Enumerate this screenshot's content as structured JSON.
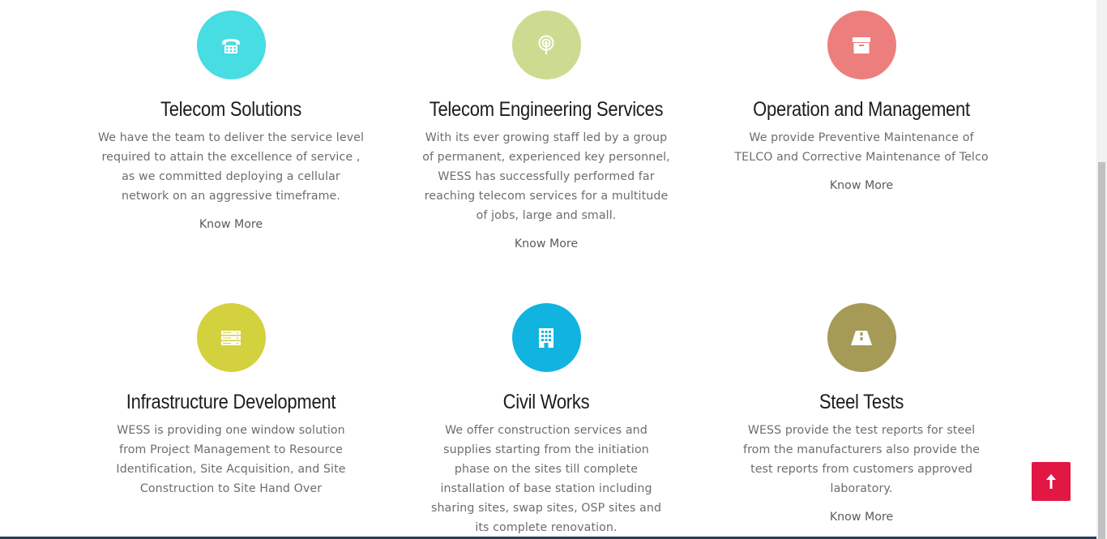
{
  "services": [
    {
      "title": "Telecom Solutions",
      "description": "We have the team to deliver the service level required to attain the excellence of service , as we committed deploying a cellular network on an aggressive timeframe.",
      "link": "Know More",
      "icon": "telephone-icon",
      "color": "#48dce3"
    },
    {
      "title": "Telecom Engineering Services",
      "description": "With its ever growing staff led by a group of permanent, experienced key personnel, WESS has successfully performed far reaching telecom services for a multitude of jobs, large and small.",
      "link": "Know More",
      "icon": "broadcast-icon",
      "color": "#cbdc90"
    },
    {
      "title": "Operation and Management",
      "description": "We provide Preventive Maintenance of TELCO and Corrective Maintenance of Telco",
      "link": "Know More",
      "icon": "archive-box-icon",
      "color": "#ec7f7d"
    },
    {
      "title": "Infrastructure Development",
      "description": "WESS is providing one window solution from Project Management to Resource Identification, Site Acquisition, and Site Construction to Site Hand Over",
      "link": "",
      "icon": "server-icon",
      "color": "#d4d13e"
    },
    {
      "title": "Civil Works",
      "description": "We offer construction services and supplies starting from the initiation phase on the sites till complete installation of base station including sharing sites, swap sites, OSP sites and its complete renovation.",
      "link": "",
      "icon": "building-icon",
      "color": "#11b4df"
    },
    {
      "title": "Steel Tests",
      "description": "WESS provide the test reports for steel from the manufacturers also provide the test reports from customers approved laboratory.",
      "link": "Know More",
      "icon": "road-icon",
      "color": "#a59a56"
    }
  ],
  "scroll_top": {
    "icon": "arrow-up-icon",
    "color": "#e11744"
  }
}
